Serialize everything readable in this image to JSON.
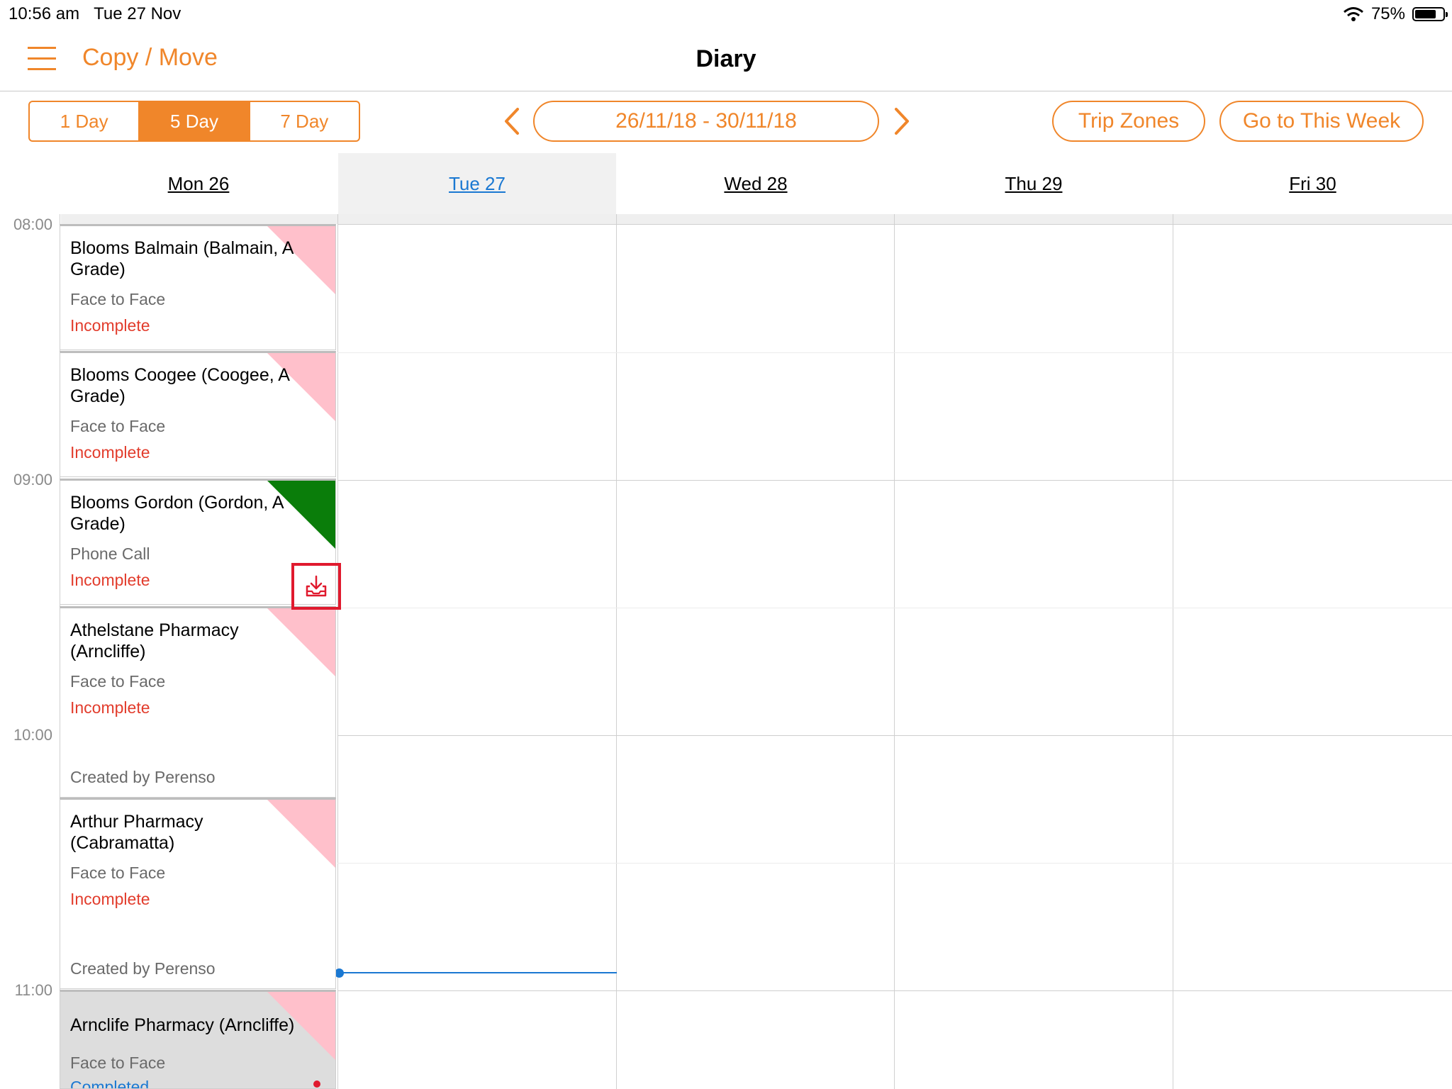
{
  "status_bar": {
    "time": "10:56 am",
    "date": "Tue 27 Nov",
    "battery": "75%",
    "battery_level": 0.75
  },
  "nav": {
    "left_title": "Copy / Move",
    "title": "Diary"
  },
  "toolbar": {
    "segments": [
      {
        "label": "1 Day",
        "active": false
      },
      {
        "label": "5 Day",
        "active": true
      },
      {
        "label": "7 Day",
        "active": false
      }
    ],
    "date_range": "26/11/18 - 30/11/18",
    "trip_zones": "Trip Zones",
    "go_to_week": "Go to This Week"
  },
  "days": [
    {
      "label": "Mon 26",
      "today": false
    },
    {
      "label": "Tue 27",
      "today": true
    },
    {
      "label": "Wed 28",
      "today": false
    },
    {
      "label": "Thu 29",
      "today": false
    },
    {
      "label": "Fri 30",
      "today": false
    }
  ],
  "times": [
    "08:00",
    "09:00",
    "10:00",
    "11:00"
  ],
  "colors": {
    "accent": "#f0862a",
    "incomplete": "#e23c2c",
    "link_blue": "#1a78d2",
    "pink_flag": "#ffc0cb",
    "green_flag": "#0a7d0a",
    "highlight_red": "#e01a2e"
  },
  "appointments": [
    {
      "name": "Blooms Balmain (Balmain, A Grade)",
      "type": "Face to Face",
      "status": "Incomplete",
      "created": "",
      "flag": "pink"
    },
    {
      "name": "Blooms Coogee (Coogee, A Grade)",
      "type": "Face to Face",
      "status": "Incomplete",
      "created": "",
      "flag": "pink"
    },
    {
      "name": "Blooms Gordon (Gordon, A Grade)",
      "type": "Phone Call",
      "status": "Incomplete",
      "created": "",
      "flag": "green",
      "icon": "download-icon"
    },
    {
      "name": "Athelstane Pharmacy (Arncliffe)",
      "type": "Face to Face",
      "status": "Incomplete",
      "created": "Created by Perenso",
      "flag": "pink"
    },
    {
      "name": "Arthur Pharmacy (Cabramatta)",
      "type": "Face to Face",
      "status": "Incomplete",
      "created": "Created by Perenso",
      "flag": "pink"
    },
    {
      "name": "Arnclife Pharmacy (Arncliffe)",
      "type": "Face to Face",
      "status": "Completed",
      "created": "",
      "flag": "pink"
    }
  ]
}
